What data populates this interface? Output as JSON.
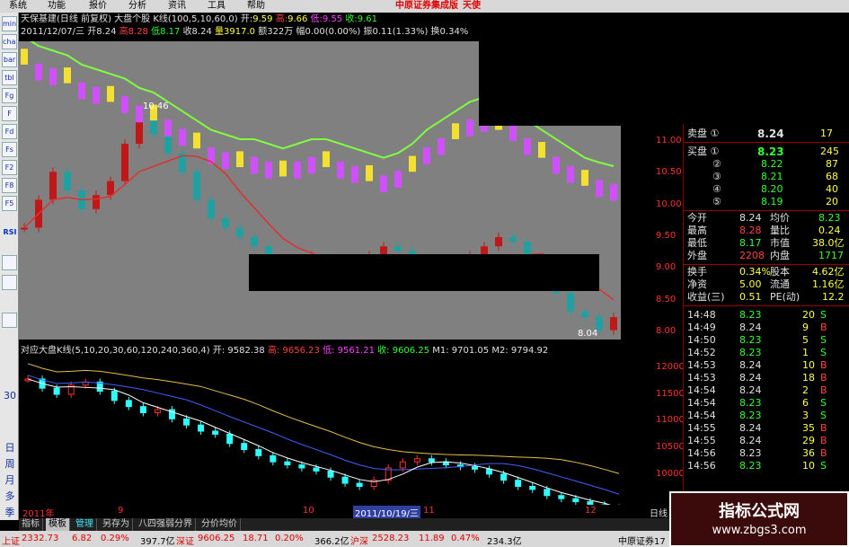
{
  "menu": {
    "items": [
      "系统",
      "功能",
      "报价",
      "分析",
      "资讯",
      "工具",
      "帮助"
    ],
    "brand": "中原证券集成版",
    "brand2": "天使"
  },
  "toolbar": {
    "buttons": [
      "mini",
      "chart",
      "bar",
      "tbl",
      "Fg",
      "F",
      "Fd",
      "Fs",
      "F2",
      "RSI",
      "F8",
      "F5"
    ],
    "chars": [
      "30",
      "日",
      "周",
      "月",
      "多",
      "季"
    ]
  },
  "header": {
    "line1": {
      "title": "天保基建(日线 前复权)",
      "chart_name": "大盘个股 K线(100,5,10,60,0)",
      "open_label": "开:",
      "open_value": "9.59",
      "high_label": "高:",
      "high_value": "9.66",
      "low_label": "低:",
      "low_value": "9.55",
      "close_label": "收:",
      "close_value": "9.61"
    },
    "line2": {
      "date": "2011/12/07/三",
      "open": "开8.24",
      "high": "高8.28",
      "low": "低8.17",
      "close": "收8.24",
      "volume": "量3917.0",
      "amount": "额322万",
      "change": "幅0.00(0.00%)",
      "amplitude": "振0.11(1.33%)",
      "turnover": "换0.34%"
    }
  },
  "sub_header": {
    "title": "对应大盘K线(5,10,20,30,60,120,240,360,4)",
    "open": "开: 9582.38",
    "high": "高: 9656.23",
    "low": "低: 9561.21",
    "close": "收: 9606.25",
    "m1": "M1: 9701.05",
    "m2": "M2: 9794.92"
  },
  "price_axis": [
    "11.00",
    "10.50",
    "10.00",
    "9.50",
    "9.00",
    "8.50",
    "8.00"
  ],
  "sub_axis": [
    "12000",
    "11500",
    "11000",
    "10500",
    "10000"
  ],
  "annotations": {
    "max_label": "10.46",
    "min_label": "8.04"
  },
  "quote_panel": {
    "sell": [
      {
        "label": "卖盘 ①",
        "price": "8.24",
        "vol": "17"
      }
    ],
    "buy": [
      {
        "label": "买盘 ①",
        "price": "8.23",
        "vol": "245"
      },
      {
        "label": "②",
        "price": "8.22",
        "vol": "87"
      },
      {
        "label": "③",
        "price": "8.21",
        "vol": "68"
      },
      {
        "label": "④",
        "price": "8.20",
        "vol": "40"
      },
      {
        "label": "⑤",
        "price": "8.19",
        "vol": "20"
      }
    ],
    "stats": [
      {
        "l1": "今开",
        "v1": "8.24",
        "l2": "均价",
        "v2": "8.23"
      },
      {
        "l1": "最高",
        "v1": "8.28",
        "l2": "量比",
        "v2": "0.24"
      },
      {
        "l1": "最低",
        "v1": "8.17",
        "l2": "市值",
        "v2": "38.0亿"
      },
      {
        "l1": "外盘",
        "v1": "2208",
        "l2": "内盘",
        "v2": "1717"
      },
      {
        "l1": "换手",
        "v1": "0.34%",
        "l2": "股本",
        "v2": "4.62亿"
      },
      {
        "l1": "净资",
        "v1": "5.00",
        "l2": "流通",
        "v2": "1.16亿"
      },
      {
        "l1": "收益(三)",
        "v1": "0.51",
        "l2": "PE(动)",
        "v2": "12.2"
      }
    ],
    "ticks": [
      {
        "time": "14:48",
        "price": "8.23",
        "vol": "20",
        "side": "S"
      },
      {
        "time": "14:49",
        "price": "8.24",
        "vol": "9",
        "side": "B"
      },
      {
        "time": "14:50",
        "price": "8.23",
        "vol": "5",
        "side": "S"
      },
      {
        "time": "14:52",
        "price": "8.23",
        "vol": "1",
        "side": "S"
      },
      {
        "time": "14:53",
        "price": "8.24",
        "vol": "10",
        "side": "B"
      },
      {
        "time": "14:53",
        "price": "8.24",
        "vol": "18",
        "side": "B"
      },
      {
        "time": "14:54",
        "price": "8.24",
        "vol": "2",
        "side": "B"
      },
      {
        "time": "14:54",
        "price": "8.23",
        "vol": "6",
        "side": "S"
      },
      {
        "time": "14:54",
        "price": "8.23",
        "vol": "3",
        "side": "S"
      },
      {
        "time": "14:55",
        "price": "8.24",
        "vol": "35",
        "side": "B"
      },
      {
        "time": "14:55",
        "price": "8.24",
        "vol": "29",
        "side": "B"
      },
      {
        "time": "14:56",
        "price": "8.23",
        "vol": "36",
        "side": "B"
      },
      {
        "time": "14:56",
        "price": "8.23",
        "vol": "10",
        "side": "S"
      }
    ]
  },
  "date_axis": {
    "labels": [
      "2011年",
      "9",
      "10",
      "2011/10/19/三",
      "11",
      "12"
    ],
    "right": "日线"
  },
  "tabs": [
    "指标",
    "模板",
    "管理",
    "另存为",
    "八四强弱分界",
    "分价均价"
  ],
  "status": {
    "sh_label": "上证",
    "sh_value": "2332.73",
    "sh_chg": "6.82",
    "sh_pct": "0.29%",
    "sh_amt": "397.7亿",
    "sz_label": "深证",
    "sz_value": "9606.25",
    "sz_chg": "18.71",
    "sz_pct": "0.20%",
    "sz_amt": "366.2亿",
    "hs_label": "沪深",
    "hs_value": "2528.23",
    "hs_chg": "11.89",
    "hs_pct": "0.47%",
    "hs_amt": "234.3亿",
    "broker": "中原证券17"
  },
  "watermark": {
    "title": "指标公式网",
    "url": "www.zbgs3.com"
  },
  "colors": {
    "up": "#ff3030",
    "down": "#30ffff",
    "ma_green": "#80ff40",
    "ma_red": "#e03030",
    "candle_yellow": "#f4e030",
    "candle_magenta": "#d050ff",
    "candle_teal": "#20a0a0",
    "candle_red": "#c01818"
  },
  "chart_data": [
    {
      "type": "candlestick",
      "title": "",
      "ylim": [
        8.0,
        11.2
      ],
      "y_ticks": [
        8.0,
        8.5,
        9.0,
        9.5,
        10.0,
        10.5,
        11.0
      ],
      "series": [
        {
          "name": "",
          "values": [
            9.2,
            9.5,
            9.8,
            9.6,
            9.4,
            9.55,
            9.7,
            10.1,
            10.46,
            10.2,
            10.0,
            9.8,
            9.5,
            9.3,
            9.2,
            9.1,
            9.0,
            8.8,
            8.7,
            8.8,
            8.9,
            8.7,
            8.6,
            8.7,
            8.9,
            9.0,
            8.95,
            8.8,
            8.7,
            8.6,
            8.8,
            8.9,
            9.0,
            9.1,
            9.05,
            8.9,
            8.7,
            8.5,
            8.3,
            8.24,
            8.1,
            8.24
          ]
        },
        {
          "name": "",
          "values": [
            11.0,
            10.9,
            10.85,
            10.8,
            10.7,
            10.65,
            10.6,
            10.55,
            10.45,
            10.4,
            10.3,
            10.2,
            10.1,
            10.0,
            9.95,
            9.9,
            9.9,
            9.85,
            9.8,
            9.85,
            9.9,
            9.9,
            9.85,
            9.8,
            9.75,
            9.7,
            9.75,
            9.85,
            10.0,
            10.1,
            10.2,
            10.3,
            10.35,
            10.3,
            10.25,
            10.1,
            10.0,
            9.9,
            9.8,
            9.7,
            9.65,
            9.61
          ]
        }
      ]
    },
    {
      "type": "candlestick",
      "title": "",
      "ylim": [
        9800,
        12200
      ],
      "y_ticks": [
        10000,
        10500,
        11000,
        11500,
        12000
      ],
      "series": [
        {
          "name": "",
          "values": [
            11850,
            11700,
            11600,
            11750,
            11800,
            11650,
            11500,
            11400,
            11300,
            11350,
            11200,
            11100,
            11000,
            10950,
            10800,
            10700,
            10600,
            10500,
            10450,
            10400,
            10350,
            10250,
            10150,
            10100,
            10200,
            10400,
            10500,
            10550,
            10500,
            10450,
            10420,
            10380,
            10300,
            10200,
            10100,
            10050,
            9950,
            9900,
            9850,
            9800,
            9750,
            9606
          ]
        }
      ]
    }
  ]
}
